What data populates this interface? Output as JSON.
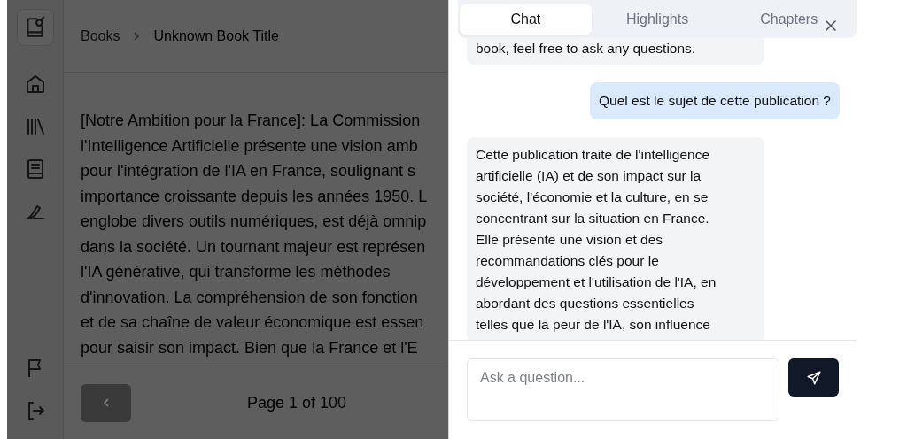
{
  "breadcrumb": [
    "Books",
    "Unknown Book Title"
  ],
  "content": {
    "lines": [
      "[Notre Ambition pour la France]: La Commission",
      "l'Intelligence Artificielle présente une vision amb",
      "pour l'intégration de l'IA en France, soulignant s",
      "importance croissante depuis les années 1950. L",
      "englobe divers outils numériques, est déjà omnip",
      "dans la société. Un tournant majeur est représen",
      "l'IA générative, qui transforme les méthodes",
      "d'innovation. La compréhension de son fonction",
      "et de sa chaîne de valeur économique est essen",
      "pour saisir son impact. Bien que la France et l'E"
    ]
  },
  "pagination": {
    "label": "Page 1 of 100"
  },
  "panel": {
    "tabs": [
      {
        "label": "Chat",
        "selected": true
      },
      {
        "label": "Highlights",
        "selected": false
      },
      {
        "label": "Chapters",
        "selected": false
      }
    ],
    "messages": [
      {
        "kind": "bot",
        "lines": [
          "book, feel free to ask any questions."
        ]
      },
      {
        "kind": "user",
        "lines": [
          "Quel est le sujet de cette publication ?"
        ]
      },
      {
        "kind": "bot",
        "lines": [
          "Cette publication traite de l'intelligence",
          "artificielle (IA) et de son impact sur la",
          "société, l'économie et la culture, en se",
          "concentrant sur la situation en France.",
          "Elle présente une vision et des",
          "recommandations clés pour le",
          "développement et l'utilisation de l'IA, en",
          "abordant des questions essentielles",
          "telles que la peur de l'IA, son influence"
        ]
      }
    ],
    "input": {
      "placeholder": "Ask a question..."
    }
  }
}
